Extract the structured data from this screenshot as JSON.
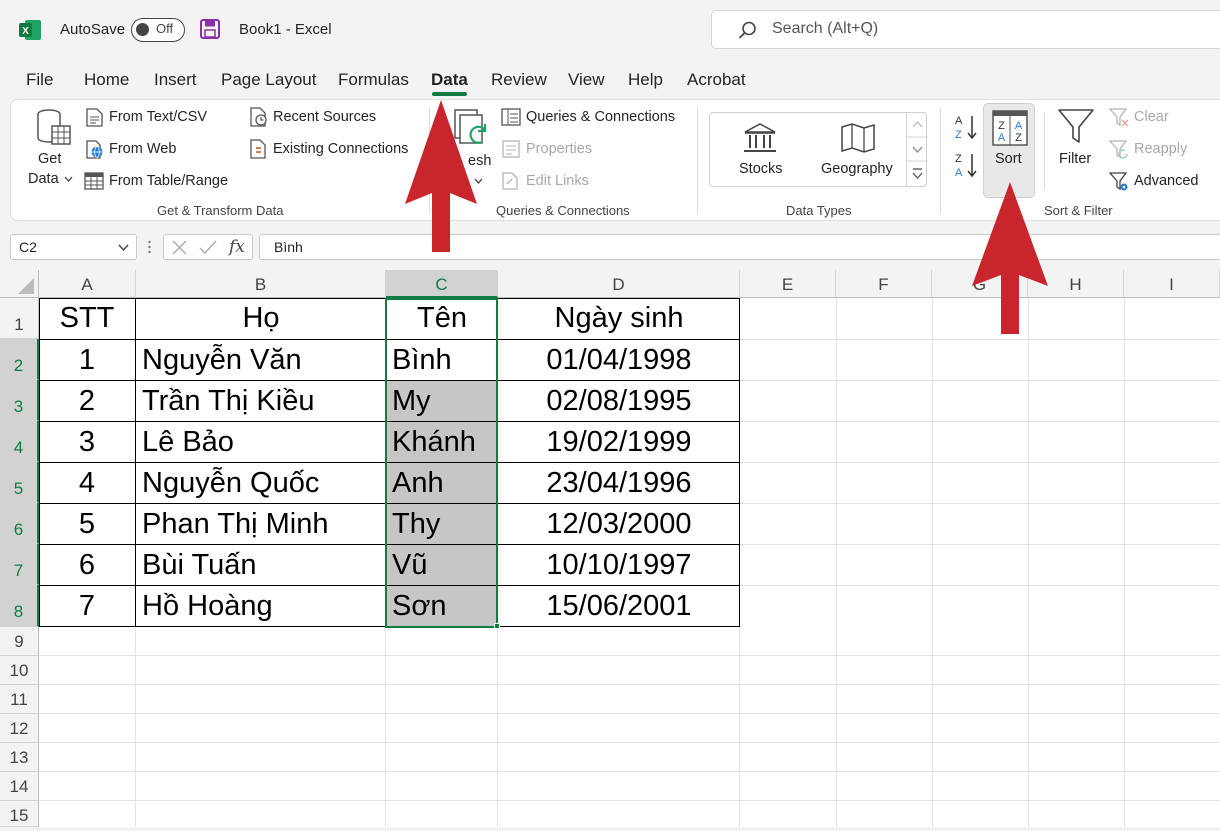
{
  "titlebar": {
    "autosave_label": "AutoSave",
    "autosave_state": "Off",
    "document_title": "Book1  -  Excel",
    "search_placeholder": "Search (Alt+Q)"
  },
  "menu": {
    "items": [
      "File",
      "Home",
      "Insert",
      "Page Layout",
      "Formulas",
      "Data",
      "Review",
      "View",
      "Help",
      "Acrobat"
    ],
    "active": "Data"
  },
  "ribbon": {
    "get_transform": {
      "get_data_line1": "Get",
      "get_data_line2": "Data",
      "from_text_csv": "From Text/CSV",
      "from_web": "From Web",
      "from_table_range": "From Table/Range",
      "recent_sources": "Recent Sources",
      "existing_connections": "Existing Connections",
      "label": "Get & Transform Data"
    },
    "queries": {
      "refresh_label": "esh",
      "queries_connections": "Queries & Connections",
      "properties": "Properties",
      "edit_links": "Edit Links",
      "label": "Queries & Connections"
    },
    "data_types": {
      "stocks": "Stocks",
      "geography": "Geography",
      "label": "Data Types"
    },
    "sort_filter": {
      "sort": "Sort",
      "filter": "Filter",
      "clear": "Clear",
      "reapply": "Reapply",
      "advanced": "Advanced",
      "label": "Sort & Filter"
    }
  },
  "formula_bar": {
    "name_box": "C2",
    "fx": "fx",
    "value": "Bình"
  },
  "sheet": {
    "columns": [
      "A",
      "B",
      "C",
      "D",
      "E",
      "F",
      "G",
      "H",
      "I"
    ],
    "rows": [
      "1",
      "2",
      "3",
      "4",
      "5",
      "6",
      "7",
      "8",
      "9",
      "10",
      "11",
      "12",
      "13",
      "14",
      "15"
    ],
    "header": {
      "stt": "STT",
      "ho": "Họ",
      "ten": "Tên",
      "ngay_sinh": "Ngày sinh"
    },
    "records": [
      {
        "stt": "1",
        "ho": "Nguyễn Văn",
        "ten": "Bình",
        "ngay_sinh": "01/04/1998"
      },
      {
        "stt": "2",
        "ho": "Trần Thị Kiều",
        "ten": "My",
        "ngay_sinh": "02/08/1995"
      },
      {
        "stt": "3",
        "ho": "Lê Bảo",
        "ten": "Khánh",
        "ngay_sinh": "19/02/1999"
      },
      {
        "stt": "4",
        "ho": "Nguyễn Quốc",
        "ten": "Anh",
        "ngay_sinh": "23/04/1996"
      },
      {
        "stt": "5",
        "ho": "Phan Thị Minh",
        "ten": "Thy",
        "ngay_sinh": "12/03/2000"
      },
      {
        "stt": "6",
        "ho": "Bùi Tuấn",
        "ten": "Vũ",
        "ngay_sinh": "10/10/1997"
      },
      {
        "stt": "7",
        "ho": "Hồ Hoàng",
        "ten": "Sơn",
        "ngay_sinh": "15/06/2001"
      }
    ],
    "selected_column": "C",
    "selected_rows": [
      "2",
      "3",
      "4",
      "5",
      "6",
      "7",
      "8"
    ]
  },
  "colors": {
    "excel_green": "#107c41",
    "annotation_red": "#c9252c",
    "selection_fill": "#c6c6c6"
  }
}
